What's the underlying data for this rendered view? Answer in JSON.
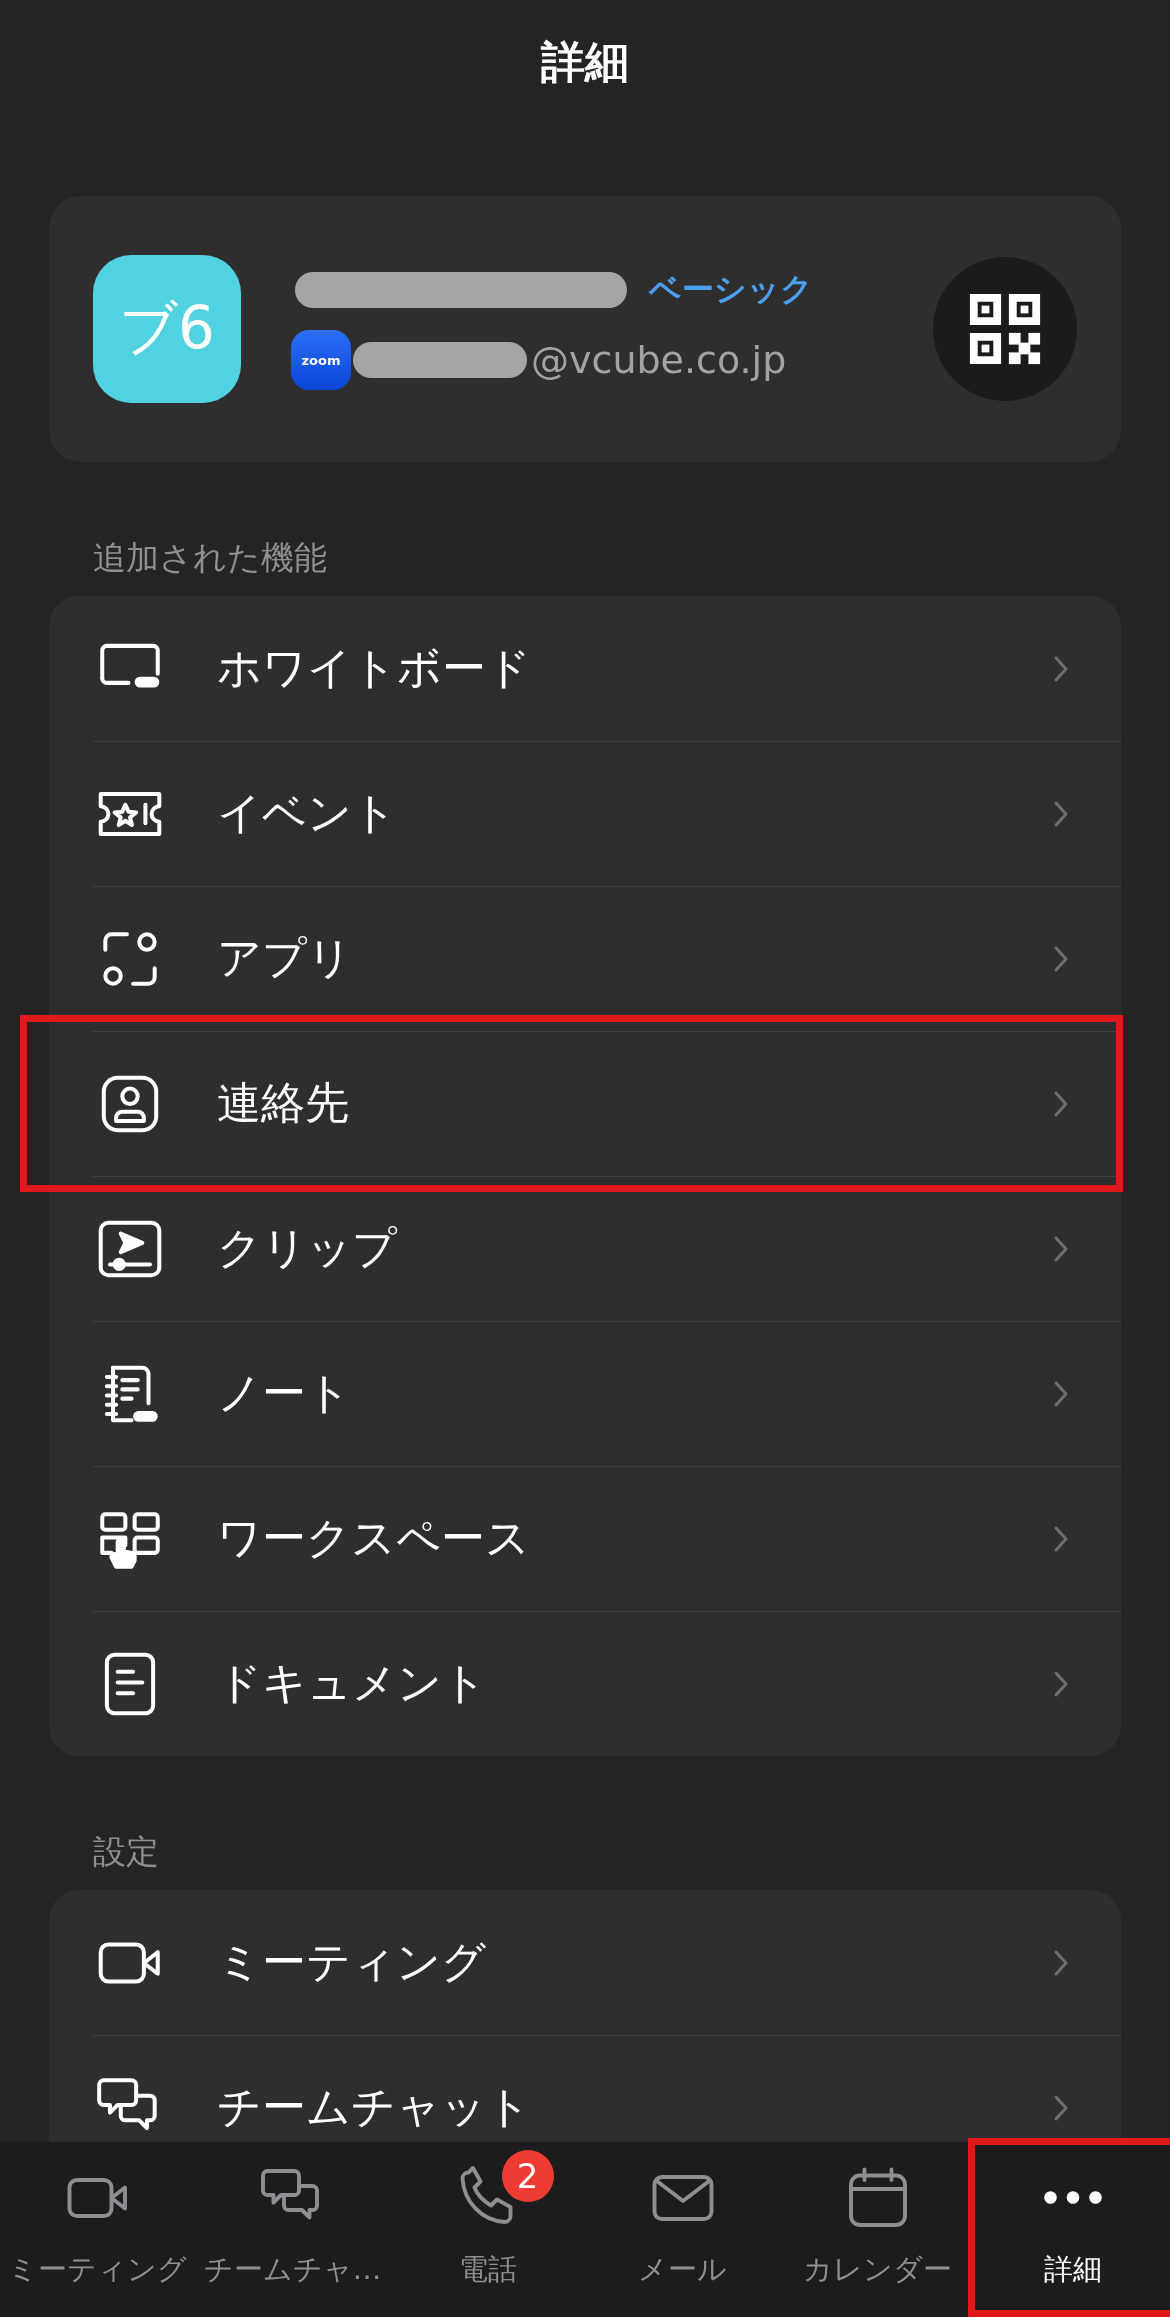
{
  "header": {
    "title": "詳細"
  },
  "profile": {
    "avatar": "ブ6",
    "plan": "ベーシック",
    "logo": "zoom",
    "email": "@vcube.co.jp"
  },
  "sections": [
    {
      "title": "追加された機能",
      "items": [
        {
          "label": "ホワイトボード",
          "highlighted": false
        },
        {
          "label": "イベント",
          "highlighted": false
        },
        {
          "label": "アプリ",
          "highlighted": false
        },
        {
          "label": "連絡先",
          "highlighted": true
        },
        {
          "label": "クリップ",
          "highlighted": false
        },
        {
          "label": "ノート",
          "highlighted": false
        },
        {
          "label": "ワークスペース",
          "highlighted": false
        },
        {
          "label": "ドキュメント",
          "highlighted": false
        }
      ]
    },
    {
      "title": "設定",
      "items": [
        {
          "label": "ミーティング",
          "highlighted": false
        },
        {
          "label": "チームチャット",
          "highlighted": false
        }
      ]
    }
  ],
  "tab_bar": [
    {
      "label": "ミーティング",
      "selected": false,
      "highlighted": false
    },
    {
      "label": "チームチャ…",
      "selected": false,
      "highlighted": false
    },
    {
      "label": "電話",
      "selected": false,
      "highlighted": false,
      "badge": "2"
    },
    {
      "label": "メール",
      "selected": false,
      "highlighted": false
    },
    {
      "label": "カレンダー",
      "selected": false,
      "highlighted": false
    },
    {
      "label": "詳細",
      "selected": true,
      "highlighted": true
    }
  ]
}
